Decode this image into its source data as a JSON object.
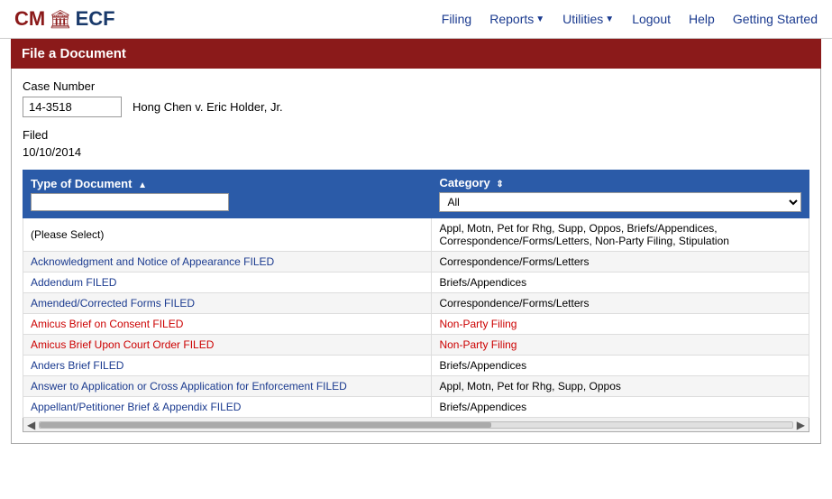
{
  "logo": {
    "cm": "CM",
    "icon": "🏛",
    "ecf": "ECF"
  },
  "nav": {
    "filing": "Filing",
    "reports": "Reports",
    "utilities": "Utilities",
    "logout": "Logout",
    "help": "Help",
    "getting_started": "Getting Started"
  },
  "page": {
    "title": "File a Document"
  },
  "case": {
    "number_label": "Case Number",
    "number_value": "14-3518",
    "case_name": "Hong Chen v. Eric Holder, Jr.",
    "filed_label": "Filed",
    "filed_date": "10/10/2014"
  },
  "table": {
    "col_type": "Type of Document",
    "col_category": "Category",
    "sort_type": "▲",
    "sort_category": "⇕",
    "filter_placeholder": "",
    "category_options": [
      "All",
      "Appl, Motn, Pet for Rhg, Supp, Oppos",
      "Briefs/Appendices",
      "Correspondence/Forms/Letters",
      "Non-Party Filing",
      "Stipulation"
    ],
    "category_default": "All",
    "rows": [
      {
        "type": "(Please Select)",
        "category": "Appl, Motn, Pet for Rhg, Supp, Oppos, Briefs/Appendices, Correspondence/Forms/Letters, Non-Party Filing, Stipulation",
        "type_style": "normal",
        "cat_style": "normal"
      },
      {
        "type": "Acknowledgment and Notice of Appearance FILED",
        "category": "Correspondence/Forms/Letters",
        "type_style": "blue",
        "cat_style": "normal"
      },
      {
        "type": "Addendum FILED",
        "category": "Briefs/Appendices",
        "type_style": "blue",
        "cat_style": "normal"
      },
      {
        "type": "Amended/Corrected Forms FILED",
        "category": "Correspondence/Forms/Letters",
        "type_style": "blue",
        "cat_style": "normal"
      },
      {
        "type": "Amicus Brief on Consent FILED",
        "category": "Non-Party Filing",
        "type_style": "red",
        "cat_style": "red"
      },
      {
        "type": "Amicus Brief Upon Court Order FILED",
        "category": "Non-Party Filing",
        "type_style": "red",
        "cat_style": "red"
      },
      {
        "type": "Anders Brief FILED",
        "category": "Briefs/Appendices",
        "type_style": "blue",
        "cat_style": "normal"
      },
      {
        "type": "Answer to Application or Cross Application for Enforcement FILED",
        "category": "Appl, Motn, Pet for Rhg, Supp, Oppos",
        "type_style": "blue",
        "cat_style": "normal"
      },
      {
        "type": "Appellant/Petitioner Brief & Appendix FILED",
        "category": "Briefs/Appendices",
        "type_style": "blue",
        "cat_style": "normal"
      }
    ]
  }
}
